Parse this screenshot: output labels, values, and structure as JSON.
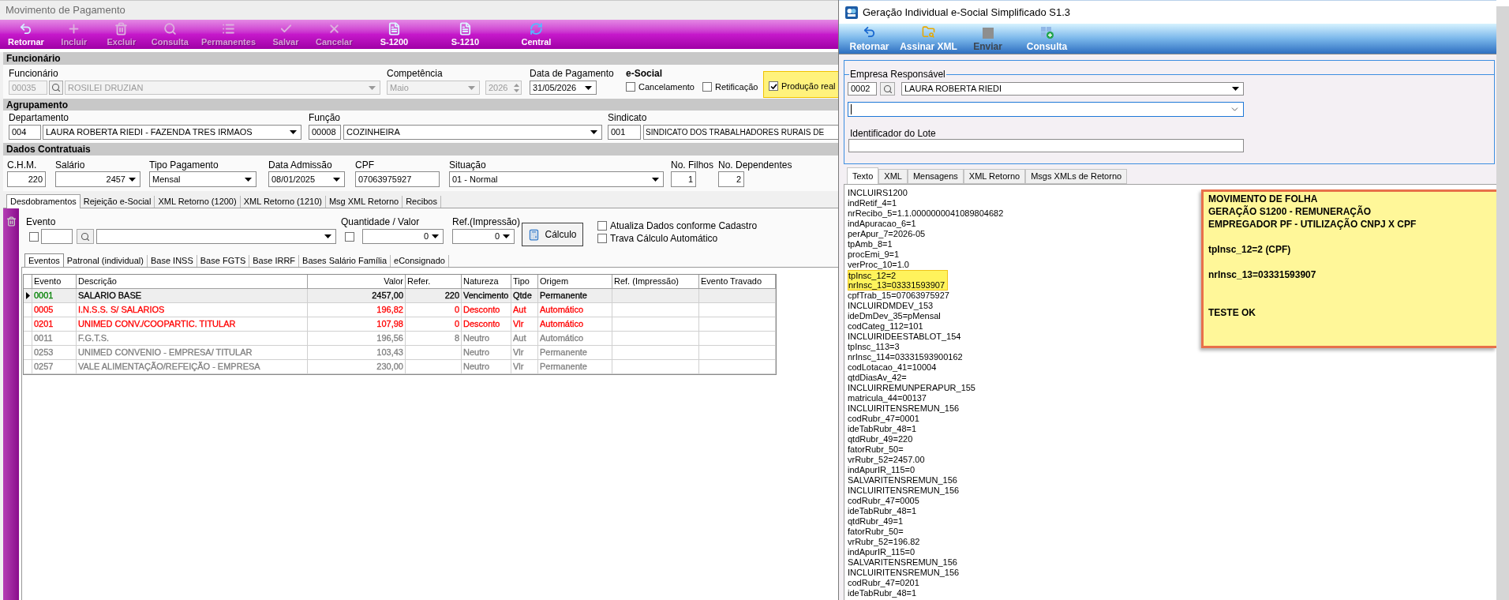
{
  "payment_window": {
    "title": "Movimento de Pagamento",
    "toolbar": [
      {
        "kind": "return",
        "label": "Retornar",
        "disabled": false
      },
      {
        "kind": "add",
        "label": "Incluir",
        "disabled": true
      },
      {
        "kind": "delete",
        "label": "Excluir",
        "disabled": true
      },
      {
        "kind": "search",
        "label": "Consulta",
        "disabled": true
      },
      {
        "kind": "list",
        "label": "Permanentes",
        "disabled": true
      },
      {
        "kind": "save",
        "label": "Salvar",
        "disabled": true
      },
      {
        "kind": "cancel",
        "label": "Cancelar",
        "disabled": true
      },
      {
        "kind": "document",
        "label": "S-1200",
        "disabled": false
      },
      {
        "kind": "document",
        "label": "S-1210",
        "disabled": false
      },
      {
        "kind": "sync",
        "label": "Central",
        "disabled": false
      }
    ],
    "employee": {
      "heading": "Funcionário",
      "label": "Funcionário",
      "code": "00035",
      "name": "ROSILEI DRUZIAN",
      "disabled": true,
      "competence_label": "Competência",
      "month": "Maio",
      "year": "2026",
      "payment_date_label": "Data de Pagamento",
      "payment_date": "31/05/2026",
      "esocial_label": "e-Social",
      "esocial_options": [
        {
          "label": "Cancelamento",
          "checked": false,
          "highlighted": false
        },
        {
          "label": "Retificação",
          "checked": false,
          "highlighted": false
        },
        {
          "label": "Produção real",
          "checked": true,
          "highlighted": true
        }
      ]
    },
    "grouping": {
      "heading": "Agrupamento",
      "fields": [
        {
          "kind": "combo",
          "label": "Departamento",
          "code": "004",
          "value": "LAURA ROBERTA RIEDI - FAZENDA TRES IRMAOS"
        },
        {
          "kind": "combo",
          "label": "Função",
          "code": "00008",
          "value": "COZINHEIRA"
        },
        {
          "kind": "text",
          "label": "Sindicato",
          "code": "001",
          "value": "SINDICATO DOS TRABALHADORES RURAIS DE"
        }
      ]
    },
    "contract": {
      "heading": "Dados Contratuais",
      "fields": [
        {
          "kind": "number",
          "label": "C.H.M.",
          "value": "220"
        },
        {
          "kind": "numcombo",
          "label": "Salário",
          "value": "2457"
        },
        {
          "kind": "combo",
          "label": "Tipo Pagamento",
          "value": "Mensal"
        },
        {
          "kind": "combo",
          "label": "Data Admissão",
          "value": "08/01/2025"
        },
        {
          "kind": "text",
          "label": "CPF",
          "value": "07063975927"
        },
        {
          "kind": "combo",
          "label": "Situação",
          "value": "01 - Normal"
        },
        {
          "kind": "number",
          "label": "No. Filhos",
          "value": "1"
        },
        {
          "kind": "number",
          "label": "No. Dependentes",
          "value": "2"
        }
      ]
    },
    "tabs": [
      {
        "label": "Desdobramentos",
        "selected": true
      },
      {
        "label": "Rejeição e-Social",
        "selected": false
      },
      {
        "label": "XML Retorno (1200)",
        "selected": false
      },
      {
        "label": "XML Retorno (1210)",
        "selected": false
      },
      {
        "label": "Msg XML Retorno",
        "selected": false
      },
      {
        "label": "Recibos",
        "selected": false
      }
    ],
    "event_entry": {
      "label": "Evento",
      "checked": false,
      "quantity_label": "Quantidade / Valor",
      "quantity_checked": false,
      "quantity": "0",
      "print_ref_label": "Ref.(Impressão)",
      "print_ref": "0",
      "calc_button": "Cálculo",
      "options": [
        {
          "label": "Atualiza Dados conforme Cadastro",
          "checked": false
        },
        {
          "label": "Trava Cálculo Automático",
          "checked": false
        }
      ]
    },
    "subtabs": [
      {
        "label": "Eventos",
        "selected": true
      },
      {
        "label": "Patronal (individual)",
        "selected": false
      },
      {
        "label": "Base INSS",
        "selected": false
      },
      {
        "label": "Base FGTS",
        "selected": false
      },
      {
        "label": "Base IRRF",
        "selected": false
      },
      {
        "label": "Bases Salário Família",
        "selected": false
      },
      {
        "label": "eConsignado",
        "selected": false
      }
    ],
    "table": {
      "columns": [
        "Evento",
        "Descrição",
        "Valor",
        "Refer.",
        "Natureza",
        "Tipo",
        "Origem",
        "Ref. (Impressão)",
        "Evento Travado"
      ],
      "rows": [
        {
          "selected": true,
          "color": "#000000",
          "code": {
            "text": "0001",
            "color": "#008000"
          },
          "description": "SALARIO BASE",
          "value": "2457,00",
          "reference": "220",
          "nature": "Vencimento",
          "type": "Qtde",
          "origin": "Permanente"
        },
        {
          "selected": false,
          "color": "#ff0000",
          "code": {
            "text": "0005",
            "color": "#ff0000"
          },
          "description": "I.N.S.S. S/ SALARIOS",
          "value": "196,82",
          "reference": "0",
          "nature": "Desconto",
          "type": "Aut",
          "origin": "Automático"
        },
        {
          "selected": false,
          "color": "#ff0000",
          "code": {
            "text": "0201",
            "color": "#ff0000"
          },
          "description": "UNIMED CONV./COOPARTIC. TITULAR",
          "value": "107,98",
          "reference": "0",
          "nature": "Desconto",
          "type": "Vlr",
          "origin": "Automático"
        },
        {
          "selected": false,
          "color": "#808080",
          "code": {
            "text": "0011",
            "color": "#808080"
          },
          "description": "F.G.T.S.",
          "value": "196,56",
          "reference": "8",
          "nature": "Neutro",
          "type": "Aut",
          "origin": "Automático"
        },
        {
          "selected": false,
          "color": "#808080",
          "code": {
            "text": "0253",
            "color": "#808080"
          },
          "description": "UNIMED CONVENIO - EMPRESA/ TITULAR",
          "value": "103,43",
          "nature": "Neutro",
          "type": "Vlr",
          "origin": "Permanente"
        },
        {
          "selected": false,
          "color": "#808080",
          "code": {
            "text": "0257",
            "color": "#808080"
          },
          "description": "VALE ALIMENTAÇÃO/REFEIÇÃO - EMPRESA",
          "value": "230,00",
          "nature": "Neutro",
          "type": "Vlr",
          "origin": "Permanente"
        }
      ]
    }
  },
  "esocial_window": {
    "title": "Geração Individual e-Social Simplificado S1.3",
    "toolbar": [
      {
        "kind": "return",
        "label": "Retornar",
        "disabled": false
      },
      {
        "kind": "sign",
        "label": "Assinar XML",
        "disabled": false
      },
      {
        "kind": "send",
        "label": "Enviar",
        "disabled": true
      },
      {
        "kind": "query",
        "label": "Consulta",
        "disabled": false
      }
    ],
    "company": {
      "legend": "Empresa Responsável",
      "code": "0002",
      "name": "LAURA ROBERTA RIEDI"
    },
    "unlabeled_select": {
      "focused": true
    },
    "batch": {
      "label": "Identificador do Lote"
    },
    "tabs": [
      {
        "label": "Texto",
        "selected": true
      },
      {
        "label": "XML",
        "selected": false
      },
      {
        "label": "Mensagens",
        "selected": false
      },
      {
        "label": "XML Retorno",
        "selected": false
      },
      {
        "label": "Msgs XMLs de Retorno",
        "selected": false
      }
    ],
    "text_lines": [
      {
        "text": "INCLUIRS1200",
        "highlighted": false
      },
      {
        "text": "indRetif_4=1",
        "highlighted": false
      },
      {
        "text": "nrRecibo_5=1.1.0000000041089804682",
        "highlighted": false
      },
      {
        "text": "indApuracao_6=1",
        "highlighted": false
      },
      {
        "text": "perApur_7=2026-05",
        "highlighted": false
      },
      {
        "text": "tpAmb_8=1",
        "highlighted": false
      },
      {
        "text": "procEmi_9=1",
        "highlighted": false
      },
      {
        "text": "verProc_10=1.0",
        "highlighted": false
      },
      {
        "text": "tpInsc_12=2",
        "highlighted": true
      },
      {
        "text": "nrInsc_13=03331593907",
        "highlighted": true
      },
      {
        "text": "cpfTrab_15=07063975927",
        "highlighted": false
      },
      {
        "text": "INCLUIRDMDEV_153",
        "highlighted": false
      },
      {
        "text": "ideDmDev_35=pMensal",
        "highlighted": false
      },
      {
        "text": "codCateg_112=101",
        "highlighted": false
      },
      {
        "text": "INCLUIRIDEESTABLOT_154",
        "highlighted": false
      },
      {
        "text": "tpInsc_113=3",
        "highlighted": false
      },
      {
        "text": "nrInsc_114=03331593900162",
        "highlighted": false
      },
      {
        "text": "codLotacao_41=10004",
        "highlighted": false
      },
      {
        "text": "qtdDiasAv_42=",
        "highlighted": false
      },
      {
        "text": "INCLUIRREMUNPERAPUR_155",
        "highlighted": false
      },
      {
        "text": "matricula_44=00137",
        "highlighted": false
      },
      {
        "text": "INCLUIRITENSREMUN_156",
        "highlighted": false
      },
      {
        "text": "codRubr_47=0001",
        "highlighted": false
      },
      {
        "text": "ideTabRubr_48=1",
        "highlighted": false
      },
      {
        "text": "qtdRubr_49=220",
        "highlighted": false
      },
      {
        "text": "fatorRubr_50=",
        "highlighted": false
      },
      {
        "text": "vrRubr_52=2457.00",
        "highlighted": false
      },
      {
        "text": "indApurIR_115=0",
        "highlighted": false
      },
      {
        "text": "SALVARITENSREMUN_156",
        "highlighted": false
      },
      {
        "text": "INCLUIRITENSREMUN_156",
        "highlighted": false
      },
      {
        "text": "codRubr_47=0005",
        "highlighted": false
      },
      {
        "text": "ideTabRubr_48=1",
        "highlighted": false
      },
      {
        "text": "qtdRubr_49=1",
        "highlighted": false
      },
      {
        "text": "fatorRubr_50=",
        "highlighted": false
      },
      {
        "text": "vrRubr_52=196.82",
        "highlighted": false
      },
      {
        "text": "indApurIR_115=0",
        "highlighted": false
      },
      {
        "text": "SALVARITENSREMUN_156",
        "highlighted": false
      },
      {
        "text": "INCLUIRITENSREMUN_156",
        "highlighted": false
      },
      {
        "text": "codRubr_47=0201",
        "highlighted": false
      },
      {
        "text": "ideTabRubr_48=1",
        "highlighted": false
      }
    ],
    "note": {
      "paragraphs": [
        [
          "MOVIMENTO DE FOLHA",
          "GERAÇÃO S1200 - REMUNERAÇÃO",
          "EMPREGADOR PF - UTILIZAÇÃO CNPJ X CPF"
        ],
        [
          "tpInsc_12=2 (CPF)"
        ],
        [
          "nrInsc_13=03331593907"
        ],
        [
          "TESTE OK"
        ]
      ]
    }
  }
}
